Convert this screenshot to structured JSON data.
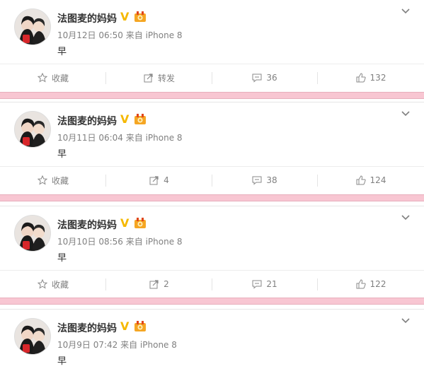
{
  "colors": {
    "accent_verified": "#f5b800",
    "separator_pink": "#f8c6d2",
    "meta_gray": "#808080"
  },
  "posts": [
    {
      "author": "法图麦的妈妈",
      "meta": "10月12日 06:50 来自 iPhone 8",
      "text": "早",
      "actions": {
        "favorite": "收藏",
        "repost": "转发",
        "comments": "36",
        "likes": "132"
      }
    },
    {
      "author": "法图麦的妈妈",
      "meta": "10月11日 06:04 来自 iPhone 8",
      "text": "早",
      "actions": {
        "favorite": "收藏",
        "repost": "4",
        "comments": "38",
        "likes": "124"
      }
    },
    {
      "author": "法图麦的妈妈",
      "meta": "10月10日 08:56 来自 iPhone 8",
      "text": "早",
      "actions": {
        "favorite": "收藏",
        "repost": "2",
        "comments": "21",
        "likes": "122"
      }
    },
    {
      "author": "法图麦的妈妈",
      "meta": "10月9日 07:42 来自 iPhone 8",
      "text": "早"
    }
  ],
  "icons": {
    "verified": "verified-v-icon",
    "medal": "medal-badge-icon",
    "expand": "chevron-down-icon",
    "favorite": "star-icon",
    "repost": "repost-arrow-icon",
    "comment": "comment-bubble-icon",
    "like": "thumbs-up-icon"
  },
  "verified_mark": "V"
}
